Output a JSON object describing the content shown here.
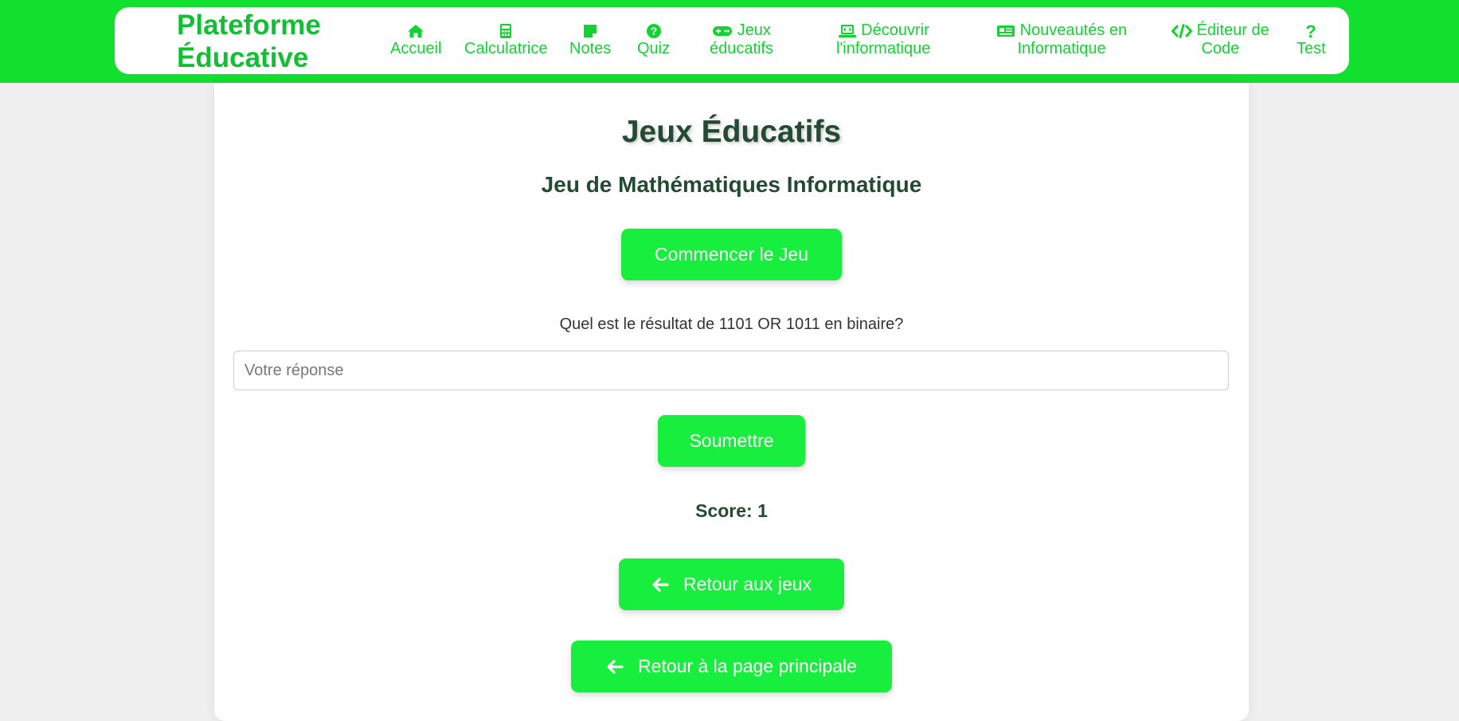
{
  "header": {
    "brand_line1": "Plateforme",
    "brand_line2": "Éducative",
    "nav": {
      "accueil": "Accueil",
      "calculatrice": "Calculatrice",
      "notes": "Notes",
      "quiz": "Quiz",
      "jeux_line1": "Jeux",
      "jeux_line2": "éducatifs",
      "decouvrir_line1": "Découvrir",
      "decouvrir_line2": "l'informatique",
      "nouveautes_line1": "Nouveautés en",
      "nouveautes_line2": "Informatique",
      "editeur_line1": "Éditeur de",
      "editeur_line2": "Code",
      "test": "Test"
    },
    "icons": [
      "home-icon",
      "calculator-icon",
      "sticky-note-icon",
      "question-circle-icon",
      "gamepad-icon",
      "laptop-code-icon",
      "newspaper-icon",
      "code-icon",
      "question-icon"
    ]
  },
  "main": {
    "title": "Jeux Éducatifs",
    "subtitle": "Jeu de Mathématiques Informatique",
    "start_button": "Commencer le Jeu",
    "question": "Quel est le résultat de 1101 OR 1011 en binaire?",
    "answer_placeholder": "Votre réponse",
    "answer_value": "",
    "submit_button": "Soumettre",
    "score": "Score: 1",
    "back_games": "Retour aux jeux",
    "back_home": "Retour à la page principale"
  },
  "colors": {
    "accent": "#12e02f",
    "brand": "#10c032",
    "button": "#18ee3e",
    "heading": "#244a33",
    "background": "#efefef"
  }
}
